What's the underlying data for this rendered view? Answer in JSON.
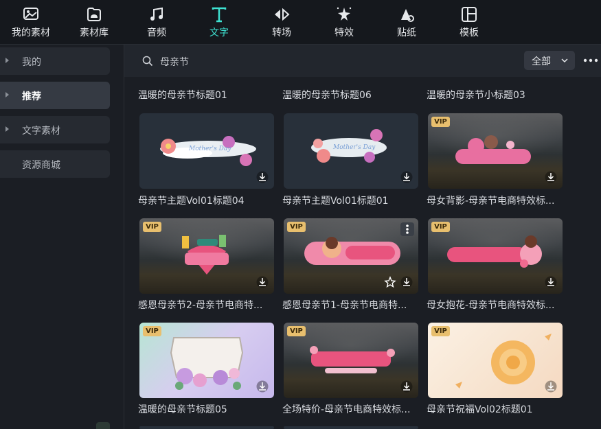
{
  "toolbar": {
    "items": [
      {
        "label": "我的素材",
        "icon": "my-assets-icon"
      },
      {
        "label": "素材库",
        "icon": "stock-library-icon"
      },
      {
        "label": "音频",
        "icon": "music-note-icon"
      },
      {
        "label": "文字",
        "icon": "text-t-icon",
        "active": true
      },
      {
        "label": "转场",
        "icon": "transition-icon"
      },
      {
        "label": "特效",
        "icon": "effects-sparkle-icon"
      },
      {
        "label": "贴纸",
        "icon": "sticker-icon"
      },
      {
        "label": "模板",
        "icon": "template-icon"
      }
    ],
    "active_color": "#3ee2d2"
  },
  "sidebar": {
    "items": [
      {
        "label": "我的",
        "expandable": true
      },
      {
        "label": "推荐",
        "expandable": true,
        "selected": true
      },
      {
        "label": "文字素材",
        "expandable": true
      },
      {
        "label": "资源商城",
        "expandable": false
      }
    ]
  },
  "search": {
    "value": "母亲节",
    "filter": "全部"
  },
  "section_titles": [
    "温暖的母亲节标题01",
    "温暖的母亲节标题06",
    "温暖的母亲节小标题03"
  ],
  "cards": [
    {
      "caption": "母亲节主题Vol01标题04",
      "vip": null
    },
    {
      "caption": "母亲节主题Vol01标题01",
      "vip": null
    },
    {
      "caption": "母女背影-母亲节电商特效标...",
      "vip": "VIP"
    },
    {
      "caption": "感恩母亲节2-母亲节电商特...",
      "vip": "VIP"
    },
    {
      "caption": "感恩母亲节1-母亲节电商特...",
      "vip": "VIP"
    },
    {
      "caption": "母女抱花-母亲节电商特效标...",
      "vip": "VIP"
    },
    {
      "caption": "温暖的母亲节标题05",
      "vip": "VIP"
    },
    {
      "caption": "全场特价-母亲节电商特效标...",
      "vip": "VIP"
    },
    {
      "caption": "母亲节祝福Vol02标题01",
      "vip": "VIP"
    }
  ]
}
